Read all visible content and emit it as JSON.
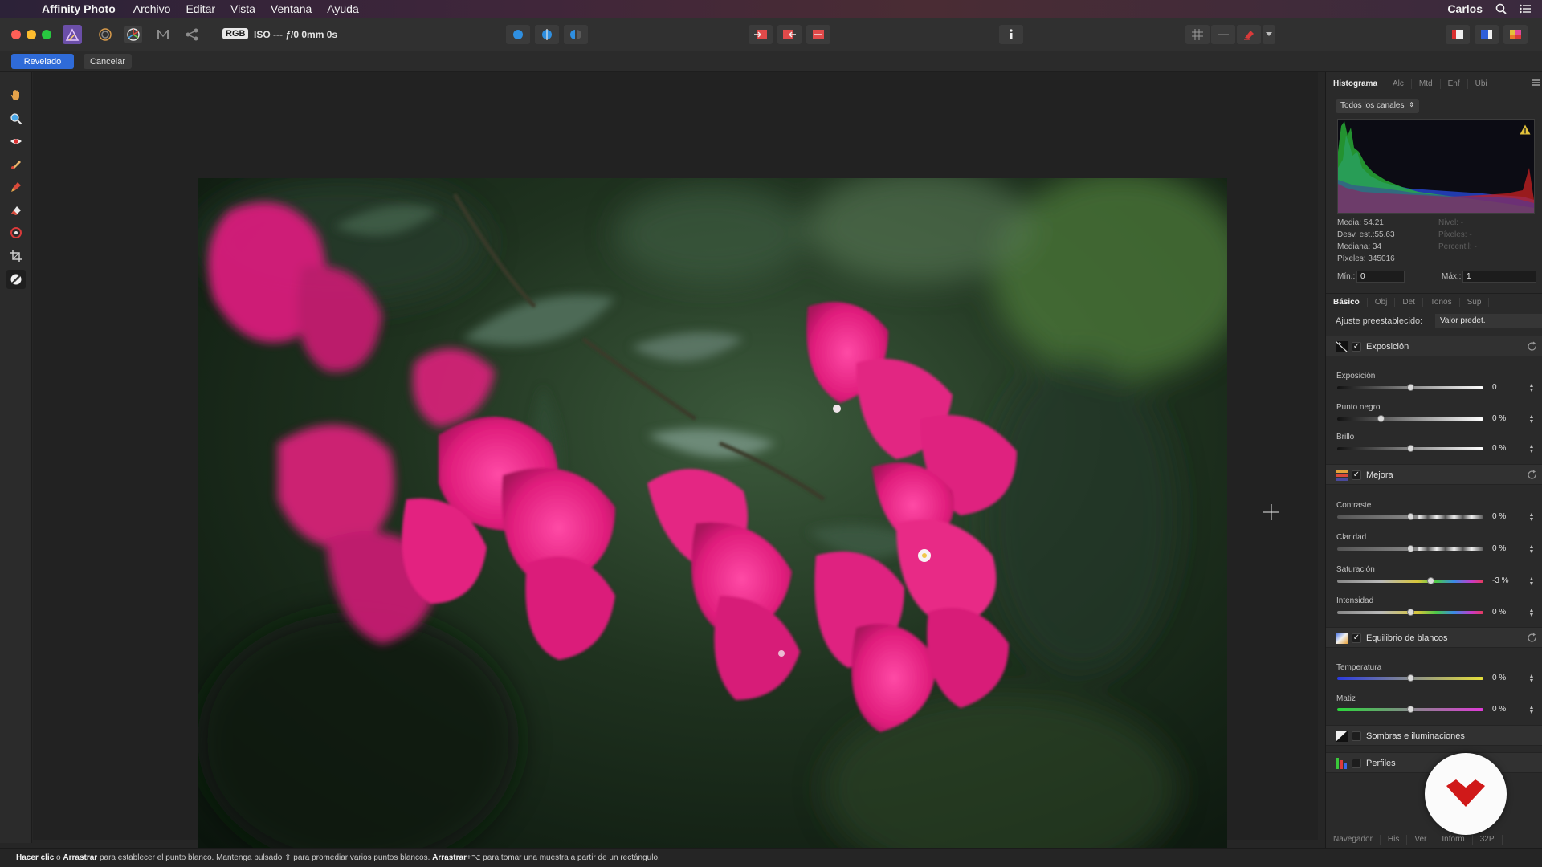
{
  "menubar": {
    "app_name": "Affinity Photo",
    "menus": [
      "Archivo",
      "Editar",
      "Vista",
      "Ventana",
      "Ayuda"
    ],
    "user": "Carlos",
    "icons": [
      "apple-icon",
      "search-icon",
      "list-icon"
    ]
  },
  "toolbar": {
    "color_mode": "RGB",
    "camera_info": "ISO --- ƒ/0 0mm 0s"
  },
  "context": {
    "develop_label": "Revelado",
    "cancel_label": "Cancelar"
  },
  "histogram_panel": {
    "tabs": [
      "Histograma",
      "Alc",
      "Mtd",
      "Enf",
      "Ubi"
    ],
    "channel": "Todos los canales",
    "stats": [
      "Media: 54.21",
      "Desv. est.:55.63",
      "Mediana: 34",
      "Píxeles: 345016"
    ],
    "stats_dim": [
      "Nivel: -",
      "Píxeles: -",
      "Percentil: -"
    ],
    "min_label": "Mín.:",
    "min_value": "0",
    "max_label": "Máx.:",
    "max_value": "1",
    "warning_color": "#e3c23a"
  },
  "develop_panel": {
    "tabs": [
      "Básico",
      "Obj",
      "Det",
      "Tonos",
      "Sup"
    ],
    "preset_label": "Ajuste preestablecido:",
    "preset_value": "Valor predet.",
    "sections": {
      "exposure": "Exposición",
      "enhance": "Mejora",
      "white_balance": "Equilibrio de blancos",
      "shadows": "Sombras e iluminaciones",
      "profiles": "Perfiles"
    },
    "check_mark": "✓",
    "sliders": {
      "exposicion": {
        "label": "Exposición",
        "value": "0",
        "level": 0.5
      },
      "punto_negro": {
        "label": "Punto negro",
        "value": "0 %",
        "level": 0.3
      },
      "brillo": {
        "label": "Brillo",
        "value": "0 %",
        "level": 0.5
      },
      "contraste": {
        "label": "Contraste",
        "value": "0 %",
        "level": 0.5
      },
      "claridad": {
        "label": "Claridad",
        "value": "0 %",
        "level": 0.5
      },
      "saturacion": {
        "label": "Saturación",
        "value": "-3 %",
        "level": 0.64
      },
      "intensidad": {
        "label": "Intensidad",
        "value": "0 %",
        "level": 0.5
      },
      "temperatura": {
        "label": "Temperatura",
        "value": "0 %",
        "level": 0.5
      },
      "matiz": {
        "label": "Matiz",
        "value": "0 %",
        "level": 0.5
      }
    },
    "bottom_tabs": [
      "Navegador",
      "His",
      "Ver",
      "Inform",
      "32P"
    ]
  },
  "status": {
    "p1": "Hacer clic",
    "p2": " o ",
    "p3": "Arrastrar",
    "p4": " para establecer el punto blanco. Mantenga pulsado ⇧ para promediar varios puntos blancos. ",
    "p5": "Arrastrar",
    "p6": "+⌥ para tomar una muestra a partir de un rectángulo."
  },
  "colors": {
    "accent": "#2f6bd8",
    "flower": "#e6207e",
    "badge_mark": "#d01919"
  }
}
